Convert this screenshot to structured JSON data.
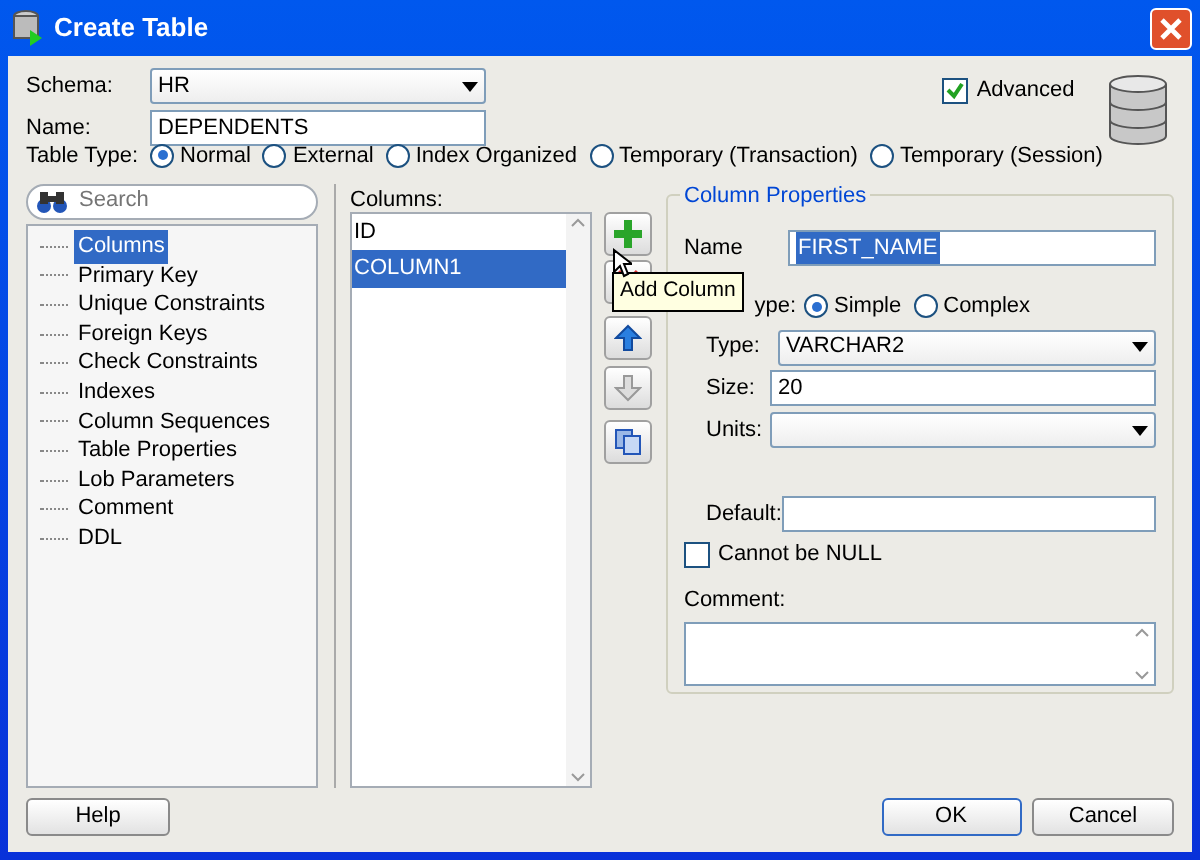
{
  "window": {
    "title": "Create Table"
  },
  "schema": {
    "label": "Schema:",
    "value": "HR"
  },
  "name": {
    "label": "Name:",
    "value": "DEPENDENTS"
  },
  "advanced": {
    "label": "Advanced",
    "checked": true
  },
  "table_type": {
    "label": "Table Type:",
    "options": [
      {
        "label": "Normal",
        "selected": true
      },
      {
        "label": "External",
        "selected": false
      },
      {
        "label": "Index Organized",
        "selected": false
      },
      {
        "label": "Temporary (Transaction)",
        "selected": false
      },
      {
        "label": "Temporary (Session)",
        "selected": false
      }
    ]
  },
  "search": {
    "placeholder": "Search"
  },
  "sidebar": {
    "items": [
      {
        "label": "Columns",
        "selected": true
      },
      {
        "label": "Primary Key",
        "selected": false
      },
      {
        "label": "Unique Constraints",
        "selected": false
      },
      {
        "label": "Foreign Keys",
        "selected": false
      },
      {
        "label": "Check Constraints",
        "selected": false
      },
      {
        "label": "Indexes",
        "selected": false
      },
      {
        "label": "Column Sequences",
        "selected": false
      },
      {
        "label": "Table Properties",
        "selected": false
      },
      {
        "label": "Lob Parameters",
        "selected": false
      },
      {
        "label": "Comment",
        "selected": false
      },
      {
        "label": "DDL",
        "selected": false
      }
    ]
  },
  "columns": {
    "label": "Columns:",
    "items": [
      {
        "label": "ID",
        "selected": false
      },
      {
        "label": "COLUMN1",
        "selected": true
      }
    ]
  },
  "tooltip": {
    "text": "Add Column"
  },
  "column_properties": {
    "title": "Column Properties",
    "name": {
      "label": "Name",
      "value": "FIRST_NAME"
    },
    "datatype": {
      "label": "ype:",
      "options": [
        {
          "label": "Simple",
          "selected": true
        },
        {
          "label": "Complex",
          "selected": false
        }
      ]
    },
    "type": {
      "label": "Type:",
      "value": "VARCHAR2"
    },
    "size": {
      "label": "Size:",
      "value": "20"
    },
    "units": {
      "label": "Units:"
    },
    "default": {
      "label": "Default:"
    },
    "not_null": {
      "label": "Cannot be NULL",
      "checked": false
    },
    "comment": {
      "label": "Comment:"
    }
  },
  "buttons": {
    "help": "Help",
    "ok": "OK",
    "cancel": "Cancel"
  }
}
